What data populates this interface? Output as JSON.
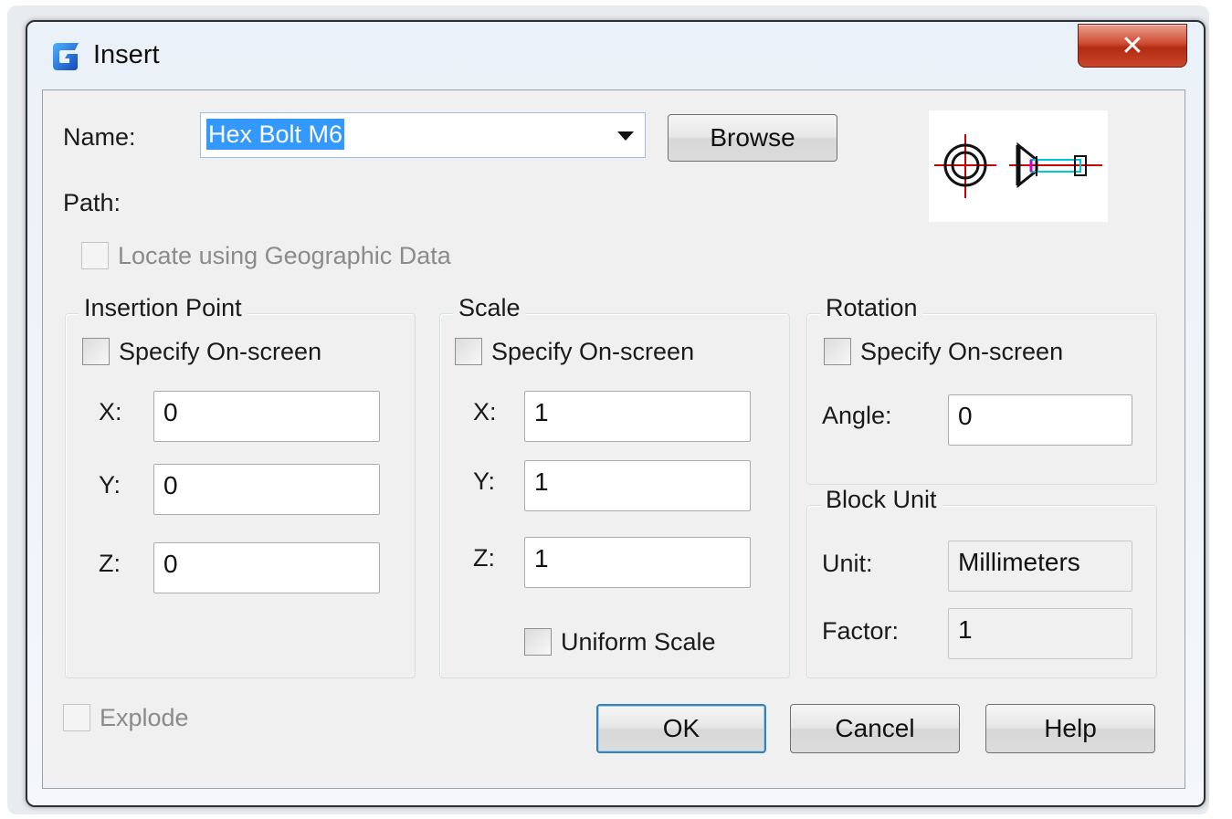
{
  "window": {
    "title": "Insert",
    "close_glyph": "✕"
  },
  "name": {
    "label": "Name:",
    "value": "Hex Bolt M6"
  },
  "browse_label": "Browse",
  "path_label": "Path:",
  "geo_label": "Locate using Geographic Data",
  "insertion": {
    "title": "Insertion Point",
    "specify": "Specify On-screen",
    "x_label": "X:",
    "x": "0",
    "y_label": "Y:",
    "y": "0",
    "z_label": "Z:",
    "z": "0"
  },
  "scale": {
    "title": "Scale",
    "specify": "Specify On-screen",
    "x_label": "X:",
    "x": "1",
    "y_label": "Y:",
    "y": "1",
    "z_label": "Z:",
    "z": "1",
    "uniform": "Uniform Scale"
  },
  "rotation": {
    "title": "Rotation",
    "specify": "Specify On-screen",
    "angle_label": "Angle:",
    "angle": "0"
  },
  "block_unit": {
    "title": "Block Unit",
    "unit_label": "Unit:",
    "unit": "Millimeters",
    "factor_label": "Factor:",
    "factor": "1"
  },
  "explode_label": "Explode",
  "buttons": {
    "ok": "OK",
    "cancel": "Cancel",
    "help": "Help"
  },
  "colors": {
    "accent": "#3399ff",
    "close": "#c9462c",
    "preview_red": "#cc0000",
    "preview_cyan": "#00c8d8",
    "preview_magenta": "#cc00cc"
  },
  "icons": {
    "app": "gcad-logo-icon",
    "dropdown": "chevron-down-icon",
    "close": "close-icon",
    "preview": "block-preview-icon"
  }
}
